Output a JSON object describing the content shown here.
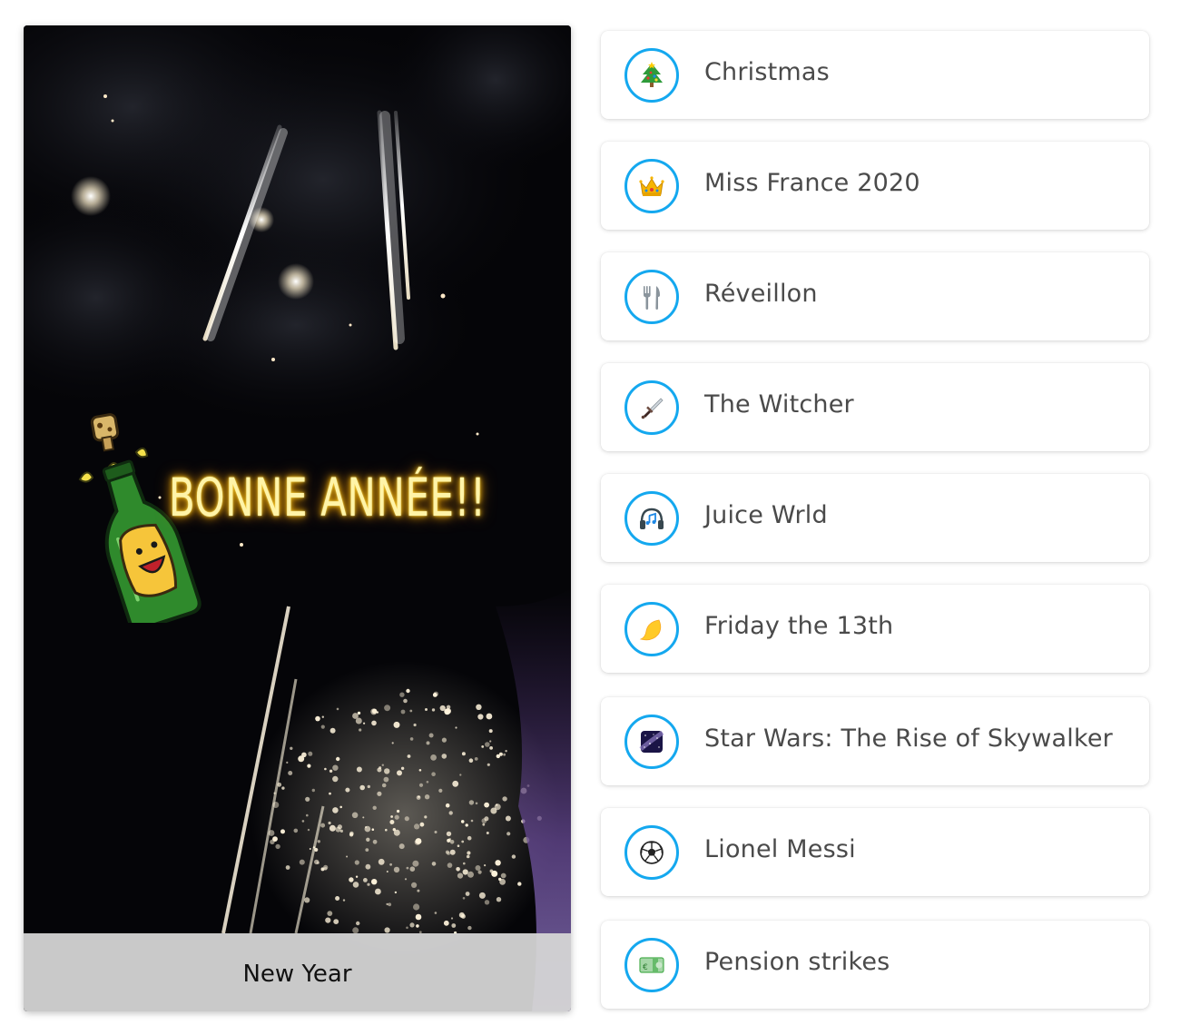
{
  "story": {
    "overlay_text": "BONNE ANNÉE!!",
    "caption": "New Year",
    "sticker_icon": "champagne-bottle-icon"
  },
  "topics": [
    {
      "label": "Christmas",
      "icon": "christmas-tree-icon"
    },
    {
      "label": "Miss France 2020",
      "icon": "crown-icon"
    },
    {
      "label": "Réveillon",
      "icon": "fork-knife-icon"
    },
    {
      "label": "The Witcher",
      "icon": "dagger-icon"
    },
    {
      "label": "Juice Wrld",
      "icon": "headphones-icon"
    },
    {
      "label": "Friday the 13th",
      "icon": "crescent-moon-icon"
    },
    {
      "label": "Star Wars: The Rise of Skywalker",
      "icon": "milky-way-icon"
    },
    {
      "label": "Lionel Messi",
      "icon": "soccer-ball-icon"
    },
    {
      "label": "Pension strikes",
      "icon": "euro-banknote-icon"
    }
  ],
  "colors": {
    "accent_ring": "#14a8ef",
    "glow_text": "#fff4a8",
    "caption_bar": "#d6d6d6",
    "label_text": "#4a4a4a"
  }
}
